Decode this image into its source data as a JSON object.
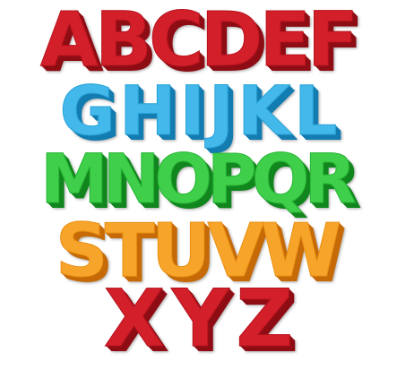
{
  "rows": [
    {
      "color": "red",
      "letters": [
        "A",
        "B",
        "C",
        "D",
        "E",
        "F"
      ]
    },
    {
      "color": "blue",
      "letters": [
        "G",
        "H",
        "I",
        "J",
        "K",
        "L"
      ]
    },
    {
      "color": "green",
      "letters": [
        "M",
        "N",
        "O",
        "P",
        "Q",
        "R"
      ]
    },
    {
      "color": "orange",
      "letters": [
        "S",
        "T",
        "U",
        "V",
        "W"
      ]
    },
    {
      "color": "red",
      "letters": [
        "X",
        "Y",
        "Z"
      ]
    }
  ],
  "colors": {
    "red": "#d21f2a",
    "blue": "#43b8ea",
    "green": "#3fcf4a",
    "orange": "#f7a52a"
  }
}
